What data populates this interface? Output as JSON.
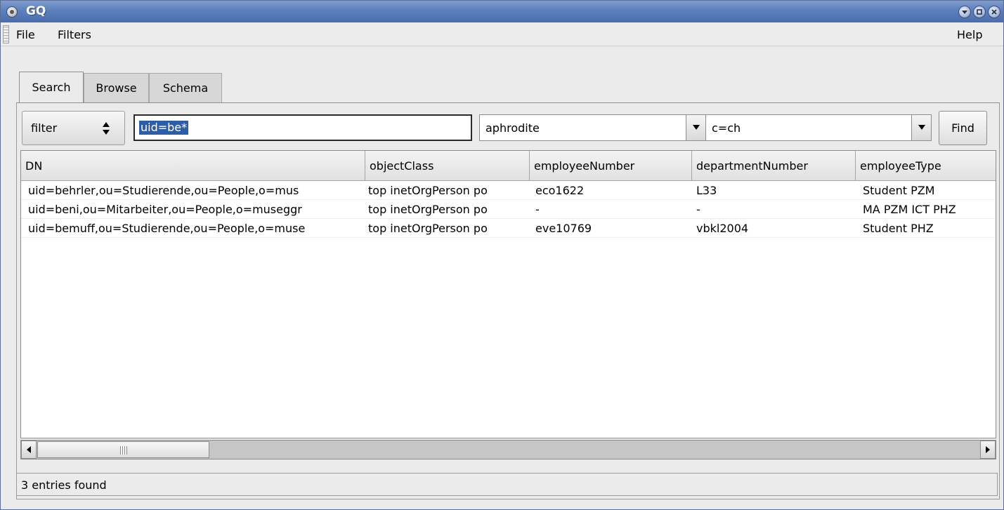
{
  "window": {
    "title": "GQ"
  },
  "menu": {
    "file": "File",
    "filters": "Filters",
    "help": "Help"
  },
  "tabs": [
    {
      "label": "Search",
      "active": true
    },
    {
      "label": "Browse",
      "active": false
    },
    {
      "label": "Schema",
      "active": false
    }
  ],
  "search": {
    "mode": "filter",
    "query": "uid=be*",
    "server": "aphrodite",
    "base": "c=ch",
    "find_label": "Find"
  },
  "table": {
    "columns": [
      "DN",
      "objectClass",
      "employeeNumber",
      "departmentNumber",
      "employeeType"
    ],
    "rows": [
      [
        "uid=behrler,ou=Studierende,ou=People,o=mus",
        "top inetOrgPerson po",
        "eco1622",
        "L33",
        "Student PZM"
      ],
      [
        "uid=beni,ou=Mitarbeiter,ou=People,o=museggr",
        "top inetOrgPerson po",
        "-",
        "-",
        "MA PZM ICT PHZ"
      ],
      [
        "uid=bemuff,ou=Studierende,ou=People,o=muse",
        "top inetOrgPerson po",
        "eve10769",
        "vbkl2004",
        "Student PHZ"
      ]
    ]
  },
  "status": {
    "text": "3 entries found"
  },
  "colors": {
    "titlebar": "#5c80bd",
    "selection": "#2e5da8",
    "window_bg": "#ebebeb"
  },
  "icons": {
    "app": "app-icon",
    "shade": "shade-icon",
    "maximize": "maximize-icon",
    "close": "close-icon",
    "combo": "chevron-down-icon",
    "spin": "up-down-arrows-icon",
    "scroll_left": "arrow-left-icon",
    "scroll_right": "arrow-right-icon"
  }
}
